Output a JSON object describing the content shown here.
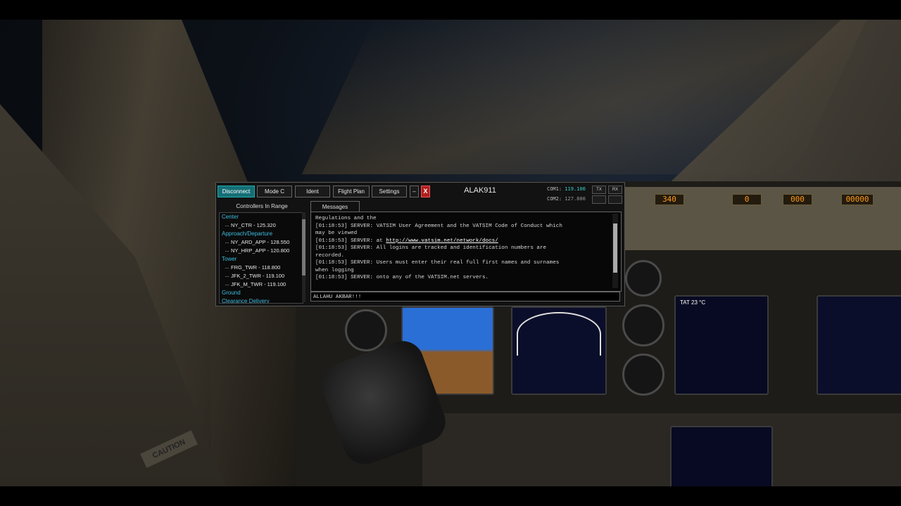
{
  "client": {
    "buttons": {
      "disconnect": "Disconnect",
      "mode_c": "Mode C",
      "ident": "Ident",
      "flight_plan": "Flight Plan",
      "settings": "Settings",
      "minimize": "–",
      "close": "X"
    },
    "callsign": "ALAK911",
    "com1": {
      "label": "COM1:",
      "freq": "119.100"
    },
    "com2": {
      "label": "COM2:",
      "freq": "127.800"
    },
    "tx_label": "TX",
    "rx_label": "RX",
    "controllers": {
      "title": "Controllers In Range",
      "groups": [
        {
          "category": "Center",
          "items": [
            "NY_CTR - 125.320"
          ]
        },
        {
          "category": "Approach/Departure",
          "items": [
            "NY_ARD_APP - 128.550",
            "NY_HRP_APP - 120.800"
          ]
        },
        {
          "category": "Tower",
          "items": [
            "FRG_TWR - 118.800",
            "JFK_2_TWR - 119.100",
            "JFK_M_TWR - 119.100"
          ]
        },
        {
          "category": "Ground",
          "items": []
        },
        {
          "category": "Clearance Delivery",
          "items": []
        }
      ]
    },
    "messages": {
      "tab_label": "Messages",
      "lines": [
        "Regulations and the",
        "[01:18:53] SERVER: VATSIM User Agreement and the VATSIM Code of Conduct which",
        "may be viewed",
        "[01:18:53] SERVER: at ",
        "[01:18:53] SERVER: All logins are tracked and identification numbers are",
        "recorded.",
        "[01:18:53] SERVER: Users must enter their real full first names and surnames",
        "when logging",
        "[01:18:53] SERVER: onto any of the VATSIM.net servers."
      ],
      "url": "http://www.vatsim.net/network/docs/"
    },
    "input_value": "ALLAHU AKBAR!!!"
  },
  "cockpit": {
    "mcp": {
      "course": "340",
      "ias_mach": "0",
      "heading": "000",
      "altitude": "00000"
    },
    "caution_label": "CAUTION",
    "eicas": {
      "tat": "TAT 23 °C"
    },
    "colors": {
      "accent": "#156f76",
      "close": "#b01e1e",
      "freq": "#3fd0d0",
      "category": "#3fbde0"
    }
  }
}
